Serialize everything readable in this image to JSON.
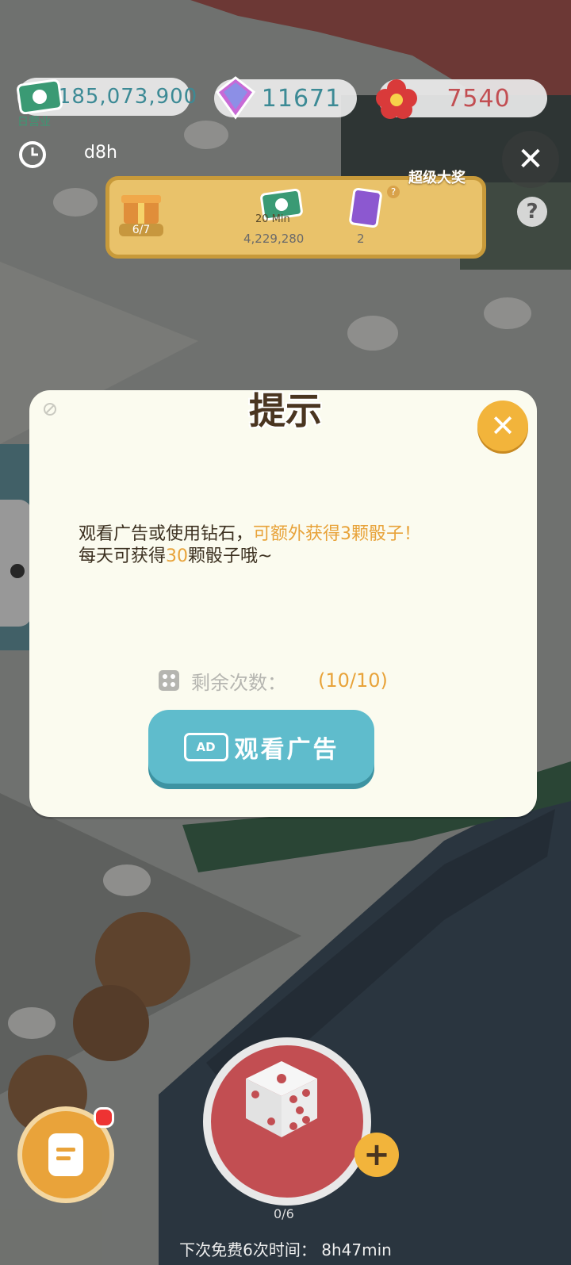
{
  "hud": {
    "cash": "185,073,900",
    "cash_caption": "日营业",
    "gems": "11671",
    "flowers": "7540",
    "timer": "d8h",
    "close_icon": "close-icon",
    "help_icon": "?"
  },
  "bonus": {
    "grand_prize": "超级大奖",
    "gift_progress": "6/7",
    "cash_duration": "20 Min",
    "cash_amount": "4,229,280",
    "card_count": "2"
  },
  "dialog": {
    "title": "提示",
    "line1_a": "观看广告或使用钻石，",
    "line1_b": "可额外获得3颗骰子！",
    "line2_a": "每天可获得",
    "line2_b": "30",
    "line2_c": "颗骰子哦~",
    "remain_label": "剩余次数：",
    "remain_value": "(10/10)",
    "ad_badge": "AD",
    "ad_button": "观看广告"
  },
  "bottom": {
    "dice_count": "0/6",
    "plus": "+",
    "next_free": "下次免费6次时间：  8h47min"
  },
  "colors": {
    "accent_orange": "#e8a33a",
    "button_teal": "#5fbccc",
    "dialog_bg": "#fbfbef"
  }
}
